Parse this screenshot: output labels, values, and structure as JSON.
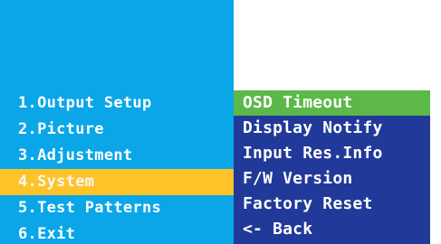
{
  "main_menu": {
    "items": [
      {
        "label": "1.Output Setup"
      },
      {
        "label": "2.Picture"
      },
      {
        "label": "3.Adjustment"
      },
      {
        "label": "4.System"
      },
      {
        "label": "5.Test Patterns"
      },
      {
        "label": "6.Exit"
      }
    ],
    "selected_index": 3
  },
  "submenu": {
    "items": [
      {
        "label": "OSD Timeout"
      },
      {
        "label": "Display Notify"
      },
      {
        "label": "Input Res.Info"
      },
      {
        "label": "F/W Version"
      },
      {
        "label": "Factory Reset"
      },
      {
        "label": "<- Back"
      }
    ],
    "selected_index": 0
  },
  "colors": {
    "main_bg": "#0aa6e8",
    "main_selected": "#ffc32a",
    "sub_bg": "#213a99",
    "sub_selected": "#5db84a",
    "text": "#ffffff"
  }
}
